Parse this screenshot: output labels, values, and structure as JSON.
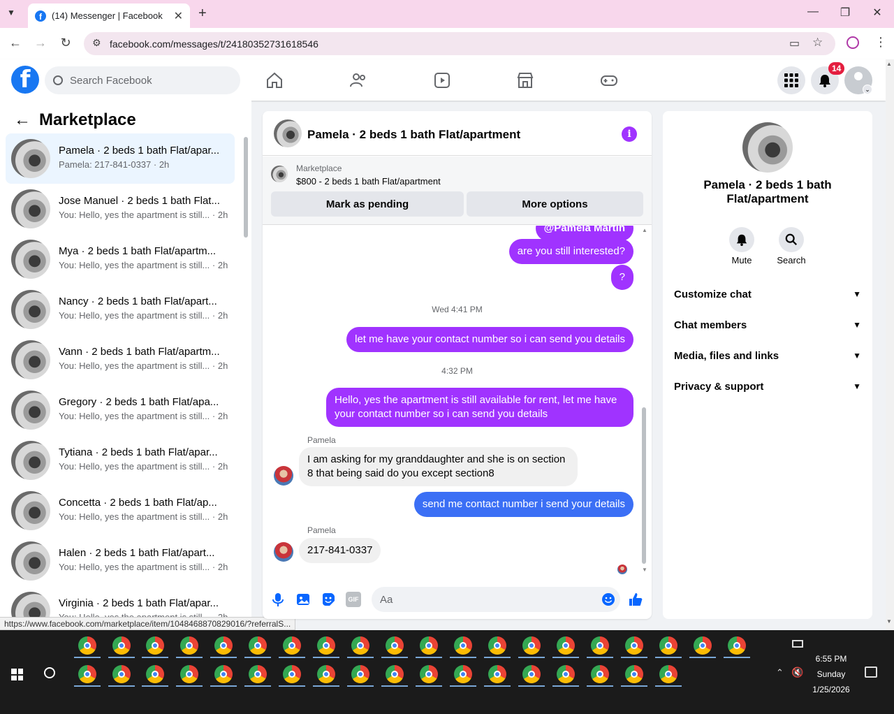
{
  "browser": {
    "tab_title": "(14) Messenger | Facebook",
    "url": "facebook.com/messages/t/24180352731618546",
    "status_url": "https://www.facebook.com/marketplace/item/1048468870829016/?referralS..."
  },
  "header": {
    "search_placeholder": "Search Facebook",
    "notification_count": "14"
  },
  "left_panel": {
    "title": "Marketplace",
    "conversations": [
      {
        "name": "Pamela · 2 beds 1 bath Flat/apar...",
        "preview": "Pamela: 217-841-0337 · 2h"
      },
      {
        "name": "Jose Manuel · 2 beds 1 bath Flat...",
        "preview": "You: Hello, yes the apartment is still... · 2h"
      },
      {
        "name": "Mya · 2 beds 1 bath Flat/apartm...",
        "preview": "You: Hello, yes the apartment is still... · 2h"
      },
      {
        "name": "Nancy · 2 beds 1 bath Flat/apart...",
        "preview": "You: Hello, yes the apartment is still... · 2h"
      },
      {
        "name": "Vann · 2 beds 1 bath Flat/apartm...",
        "preview": "You: Hello, yes the apartment is still... · 2h"
      },
      {
        "name": "Gregory · 2 beds 1 bath Flat/apa...",
        "preview": "You: Hello, yes the apartment is still... · 2h"
      },
      {
        "name": "Tytiana · 2 beds 1 bath Flat/apar...",
        "preview": "You: Hello, yes the apartment is still... · 2h"
      },
      {
        "name": "Concetta · 2 beds 1 bath Flat/ap...",
        "preview": "You: Hello, yes the apartment is still... · 2h"
      },
      {
        "name": "Halen · 2 beds 1 bath Flat/apart...",
        "preview": "You: Hello, yes the apartment is still... · 2h"
      },
      {
        "name": "Virginia · 2 beds 1 bath Flat/apar...",
        "preview": "You: Hello, yes the apartment is still... · 2h"
      }
    ]
  },
  "chat": {
    "title": "Pamela · 2 beds 1 bath Flat/apartment",
    "marketplace_label": "Marketplace",
    "listing": "$800 - 2 beds 1 bath Flat/apartment",
    "mark_pending": "Mark as pending",
    "more_options": "More options",
    "mention": "@Pamela Martin",
    "msg1": "are you still interested?",
    "msg2": "?",
    "ts1": "Wed 4:41 PM",
    "msg3": "let me have your contact number so i can send you details",
    "ts2": "4:32 PM",
    "msg4_line1": "Hello, yes the apartment is still available for rent, let me have",
    "msg4_line2": "your contact number so i can send you details",
    "sender1": "Pamela",
    "msg5_line1": "I am asking for my granddaughter and she is on section",
    "msg5_line2": "8 that being said do you except section8",
    "msg6": "send me contact number i send your details",
    "sender2": "Pamela",
    "msg7": "217-841-0337",
    "input_placeholder": "Aa",
    "gif_label": "GIF"
  },
  "right_panel": {
    "name_line1": "Pamela · 2 beds 1 bath",
    "name_line2": "Flat/apartment",
    "mute": "Mute",
    "search": "Search",
    "rows": [
      "Customize chat",
      "Chat members",
      "Media, files and links",
      "Privacy & support"
    ]
  },
  "taskbar": {
    "time": "6:55 PM",
    "day": "Sunday",
    "date": "1/25/2026"
  }
}
